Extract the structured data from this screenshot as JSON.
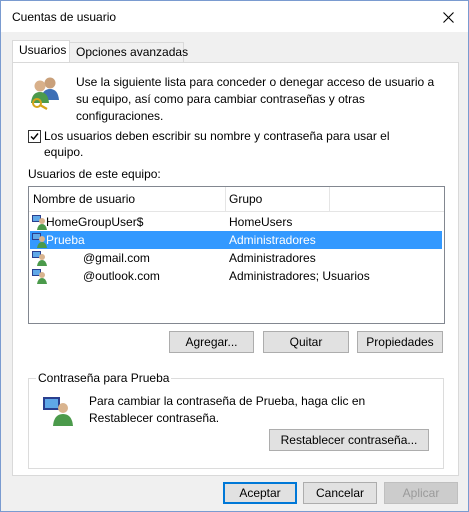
{
  "window": {
    "title": "Cuentas de usuario"
  },
  "tabs": [
    {
      "label": "Usuarios",
      "active": true
    },
    {
      "label": "Opciones avanzadas",
      "active": false
    }
  ],
  "info": {
    "text": "Use la siguiente lista para conceder o denegar acceso de usuario a su equipo, así como para cambiar contraseñas y otras configuraciones."
  },
  "checkbox": {
    "label": "Los usuarios deben escribir su nombre y contraseña para usar el equipo.",
    "checked": true
  },
  "users_label": "Usuarios de este equipo:",
  "list": {
    "columns": [
      "Nombre de usuario",
      "Grupo"
    ],
    "rows": [
      {
        "name": "HomeGroupUser$",
        "group": "HomeUsers",
        "selected": false
      },
      {
        "name": "Prueba",
        "group": "Administradores",
        "selected": true
      },
      {
        "name": "@gmail.com",
        "group": "Administradores",
        "selected": false
      },
      {
        "name": "@outlook.com",
        "group": "Administradores; Usuarios",
        "selected": false
      }
    ]
  },
  "buttons": {
    "add": "Agregar...",
    "remove": "Quitar",
    "properties": "Propiedades"
  },
  "password_group": {
    "title": "Contraseña para Prueba",
    "text": "Para cambiar la contraseña de Prueba, haga clic en Restablecer contraseña.",
    "reset": "Restablecer contraseña..."
  },
  "footer": {
    "ok": "Aceptar",
    "cancel": "Cancelar",
    "apply": "Aplicar"
  },
  "colors": {
    "selection": "#3399ff",
    "accent": "#0078d7"
  }
}
